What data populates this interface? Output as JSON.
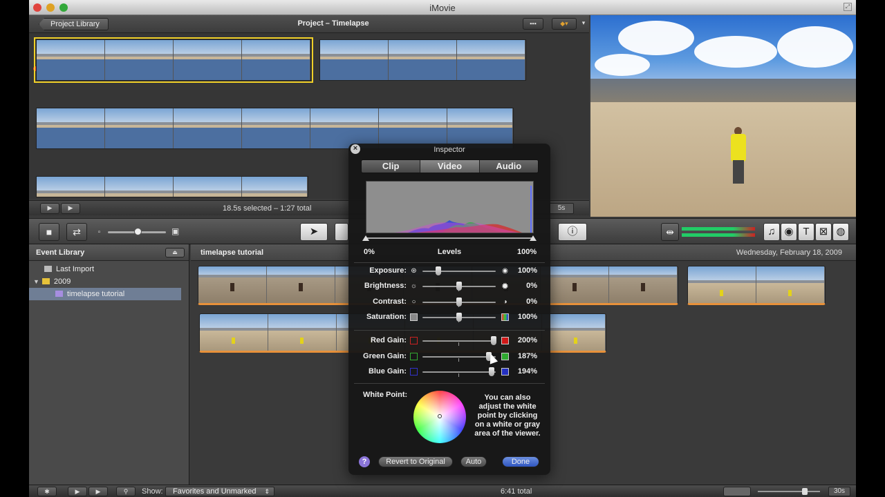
{
  "window": {
    "title": "iMovie"
  },
  "project_bar": {
    "back_label": "Project Library",
    "title": "Project – Timelapse"
  },
  "project_footer": {
    "selection_text": "18.5s selected – 1:27 total",
    "duration_label": "5s"
  },
  "event_library": {
    "title": "Event Library",
    "items": [
      {
        "label": "Last Import"
      },
      {
        "label": "2009"
      },
      {
        "label": "timelapse tutorial"
      }
    ]
  },
  "event_browser": {
    "title": "timelapse tutorial",
    "date": "Wednesday, February 18, 2009"
  },
  "bottom_bar": {
    "show_label": "Show:",
    "show_value": "Favorites and Unmarked",
    "total": "6:41 total",
    "duration_label": "30s"
  },
  "inspector": {
    "title": "Inspector",
    "tabs": [
      "Clip",
      "Video",
      "Audio"
    ],
    "active_tab": "Video",
    "levels": {
      "min_label": "0%",
      "label": "Levels",
      "max_label": "100%",
      "low": 0.0,
      "high": 1.0
    },
    "adjustments": [
      {
        "label": "Exposure:",
        "value": "100%",
        "level": 0.22
      },
      {
        "label": "Brightness:",
        "value": "0%",
        "level": 0.5
      },
      {
        "label": "Contrast:",
        "value": "0%",
        "level": 0.5
      },
      {
        "label": "Saturation:",
        "value": "100%",
        "level": 0.5
      }
    ],
    "gains": [
      {
        "label": "Red Gain:",
        "value": "200%",
        "color": "#d01818",
        "level": 0.97
      },
      {
        "label": "Green Gain:",
        "value": "187%",
        "color": "#2fa82f",
        "level": 0.91
      },
      {
        "label": "Blue Gain:",
        "value": "194%",
        "color": "#2430c0",
        "level": 0.94
      }
    ],
    "white_point_label": "White Point:",
    "white_point_help": "You can also adjust the white point by clicking on a white or gray area of the viewer.",
    "help_label": "?",
    "revert_label": "Revert to Original",
    "auto_label": "Auto",
    "done_label": "Done"
  },
  "colors": {
    "selection": "#f0d028",
    "accent_blue": "#2f56c0",
    "audio_track": "#4c6fa0",
    "event_marker": "#e8913a"
  }
}
